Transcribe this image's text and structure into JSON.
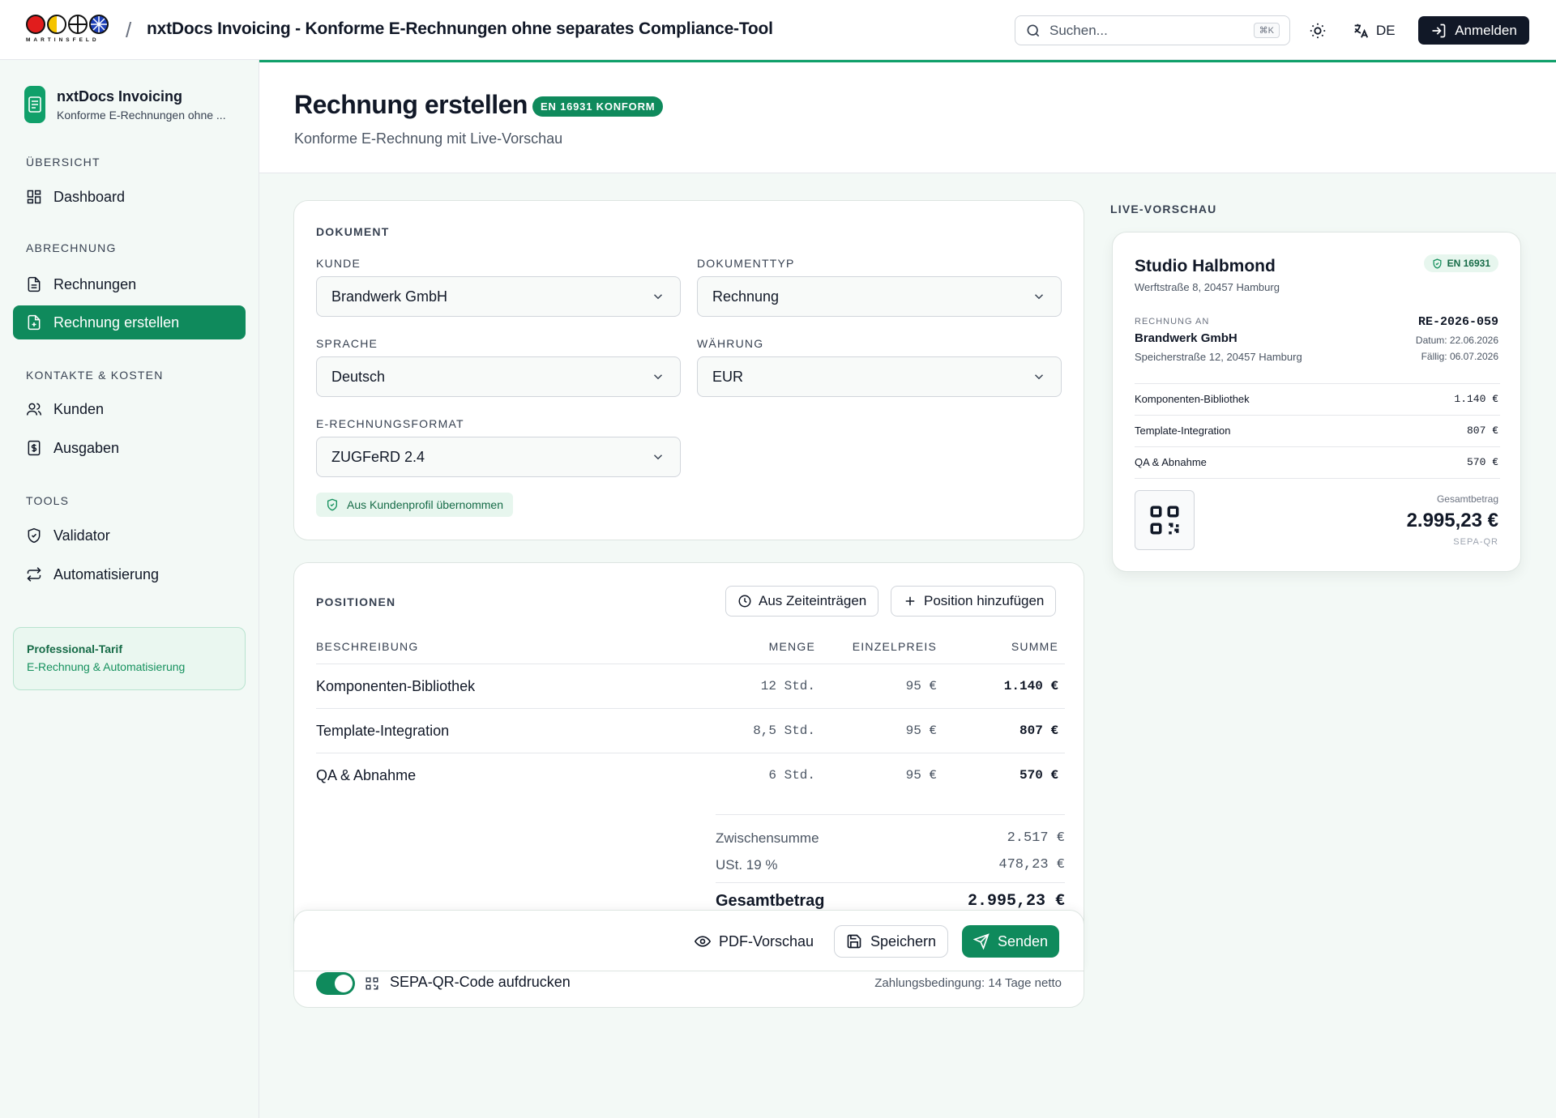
{
  "topbar": {
    "logo_text": "MARTINSFELD",
    "separator": "/",
    "title": "nxtDocs Invoicing - Konforme E-Rechnungen ohne separates Compliance-Tool",
    "search_placeholder": "Suchen...",
    "search_shortcut": "⌘K",
    "language": "DE",
    "login_label": "Anmelden"
  },
  "sidebar": {
    "brand_name": "nxtDocs Invoicing",
    "brand_sub": "Konforme E-Rechnungen ohne ...",
    "sections": {
      "overview": "ÜBERSICHT",
      "billing": "ABRECHNUNG",
      "contacts": "KONTAKTE & KOSTEN",
      "tools": "TOOLS"
    },
    "items": {
      "dashboard": "Dashboard",
      "invoices": "Rechnungen",
      "create_invoice": "Rechnung erstellen",
      "customers": "Kunden",
      "expenses": "Ausgaben",
      "validator": "Validator",
      "automation": "Automatisierung"
    },
    "plan_title": "Professional-Tarif",
    "plan_sub": "E-Rechnung & Automatisierung"
  },
  "header": {
    "title": "Rechnung erstellen",
    "badge": "EN 16931 KONFORM",
    "subtitle": "Konforme E-Rechnung mit Live-Vorschau"
  },
  "document": {
    "section": "DOKUMENT",
    "customer_label": "KUNDE",
    "customer_value": "Brandwerk GmbH",
    "doctype_label": "DOKUMENTTYP",
    "doctype_value": "Rechnung",
    "language_label": "SPRACHE",
    "language_value": "Deutsch",
    "currency_label": "WÄHRUNG",
    "currency_value": "EUR",
    "format_label": "E-RECHNUNGSFORMAT",
    "format_value": "ZUGFeRD 2.4",
    "inherit_note": "Aus Kundenprofil übernommen"
  },
  "positions": {
    "section": "POSITIONEN",
    "from_time_label": "Aus Zeiteinträgen",
    "add_label": "Position hinzufügen",
    "columns": {
      "description": "BESCHREIBUNG",
      "qty": "MENGE",
      "unit_price": "EINZELPREIS",
      "sum": "SUMME"
    },
    "rows": [
      {
        "description": "Komponenten-Bibliothek",
        "qty": "12 Std.",
        "unit_price": "95 €",
        "sum": "1.140 €"
      },
      {
        "description": "Template-Integration",
        "qty": "8,5 Std.",
        "unit_price": "95 €",
        "sum": "807 €"
      },
      {
        "description": "QA & Abnahme",
        "qty": "6 Std.",
        "unit_price": "95 €",
        "sum": "570 €"
      }
    ],
    "subtotal_label": "Zwischensumme",
    "subtotal_value": "2.517 €",
    "vat_label": "USt. 19 %",
    "vat_value": "478,23 €",
    "total_label": "Gesamtbetrag",
    "total_value": "2.995,23 €",
    "sepa_label": "SEPA-QR-Code aufdrucken",
    "payment_terms": "Zahlungsbedingung: 14 Tage netto"
  },
  "actions": {
    "pdf_preview": "PDF-Vorschau",
    "save": "Speichern",
    "send": "Senden"
  },
  "preview": {
    "section": "LIVE-VORSCHAU",
    "company": "Studio Halbmond",
    "company_address": "Werftstraße 8, 20457 Hamburg",
    "badge": "EN 16931",
    "bill_to_label": "RECHNUNG AN",
    "bill_to_name": "Brandwerk GmbH",
    "bill_to_address": "Speicherstraße 12, 20457 Hamburg",
    "invoice_no": "RE-2026-059",
    "date": "Datum: 22.06.2026",
    "due": "Fällig: 06.07.2026",
    "items": [
      {
        "name": "Komponenten-Bibliothek",
        "amount": "1.140 €"
      },
      {
        "name": "Template-Integration",
        "amount": "807 €"
      },
      {
        "name": "QA & Abnahme",
        "amount": "570 €"
      }
    ],
    "total_label": "Gesamtbetrag",
    "total_value": "2.995,23 €",
    "qr_label": "SEPA-QR"
  },
  "colors": {
    "accent": "#0f8a5c",
    "sidebar_bg": "#f3f9f6",
    "dark_button": "#111827"
  }
}
